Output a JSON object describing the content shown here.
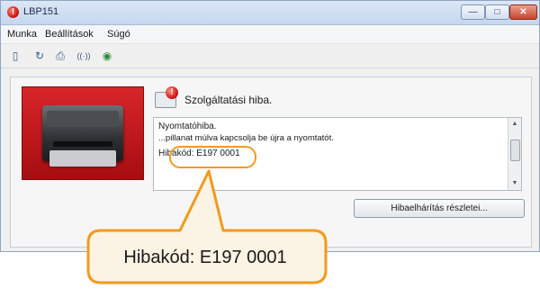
{
  "window": {
    "title": "LBP151",
    "icon": "error-icon",
    "controls": {
      "minimize": "—",
      "maximize": "□",
      "close": "✕"
    }
  },
  "menu": {
    "items": [
      "Munka",
      "Beállítások",
      "Súgó"
    ]
  },
  "toolbar": {
    "icons": [
      "view-icon",
      "refresh-icon",
      "print-icon",
      "wireless-icon",
      "globe-icon"
    ],
    "glyphs": [
      "▯",
      "↻",
      "⎙",
      "((·))",
      "◉"
    ]
  },
  "status": {
    "title": "Szolgáltatási hiba.",
    "heading": "Nyomtatóhiba.",
    "line": "...pillanat múlva kapcsolja be újra a nyomtatót.",
    "error_code": "Hibakód: E197 0001"
  },
  "buttons": {
    "details": "Hibaelhárítás részletei..."
  },
  "callout": {
    "text": "Hibakód: E197 0001"
  },
  "colors": {
    "accent": "#f29a1e",
    "callout_fill": "#fbf3e3",
    "title_bar": "#c5d6ee"
  }
}
